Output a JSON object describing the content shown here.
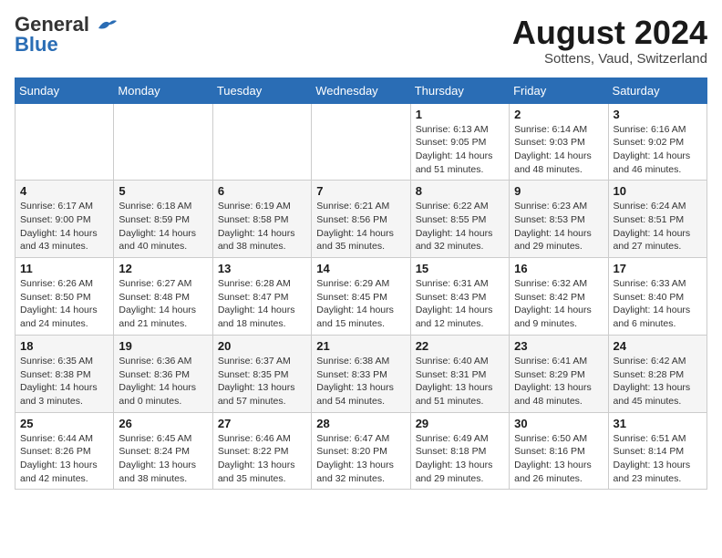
{
  "header": {
    "logo_line1": "General",
    "logo_line2": "Blue",
    "month_year": "August 2024",
    "location": "Sottens, Vaud, Switzerland"
  },
  "days_of_week": [
    "Sunday",
    "Monday",
    "Tuesday",
    "Wednesday",
    "Thursday",
    "Friday",
    "Saturday"
  ],
  "weeks": [
    {
      "days": [
        {
          "number": "",
          "info": ""
        },
        {
          "number": "",
          "info": ""
        },
        {
          "number": "",
          "info": ""
        },
        {
          "number": "",
          "info": ""
        },
        {
          "number": "1",
          "info": "Sunrise: 6:13 AM\nSunset: 9:05 PM\nDaylight: 14 hours\nand 51 minutes."
        },
        {
          "number": "2",
          "info": "Sunrise: 6:14 AM\nSunset: 9:03 PM\nDaylight: 14 hours\nand 48 minutes."
        },
        {
          "number": "3",
          "info": "Sunrise: 6:16 AM\nSunset: 9:02 PM\nDaylight: 14 hours\nand 46 minutes."
        }
      ]
    },
    {
      "days": [
        {
          "number": "4",
          "info": "Sunrise: 6:17 AM\nSunset: 9:00 PM\nDaylight: 14 hours\nand 43 minutes."
        },
        {
          "number": "5",
          "info": "Sunrise: 6:18 AM\nSunset: 8:59 PM\nDaylight: 14 hours\nand 40 minutes."
        },
        {
          "number": "6",
          "info": "Sunrise: 6:19 AM\nSunset: 8:58 PM\nDaylight: 14 hours\nand 38 minutes."
        },
        {
          "number": "7",
          "info": "Sunrise: 6:21 AM\nSunset: 8:56 PM\nDaylight: 14 hours\nand 35 minutes."
        },
        {
          "number": "8",
          "info": "Sunrise: 6:22 AM\nSunset: 8:55 PM\nDaylight: 14 hours\nand 32 minutes."
        },
        {
          "number": "9",
          "info": "Sunrise: 6:23 AM\nSunset: 8:53 PM\nDaylight: 14 hours\nand 29 minutes."
        },
        {
          "number": "10",
          "info": "Sunrise: 6:24 AM\nSunset: 8:51 PM\nDaylight: 14 hours\nand 27 minutes."
        }
      ]
    },
    {
      "days": [
        {
          "number": "11",
          "info": "Sunrise: 6:26 AM\nSunset: 8:50 PM\nDaylight: 14 hours\nand 24 minutes."
        },
        {
          "number": "12",
          "info": "Sunrise: 6:27 AM\nSunset: 8:48 PM\nDaylight: 14 hours\nand 21 minutes."
        },
        {
          "number": "13",
          "info": "Sunrise: 6:28 AM\nSunset: 8:47 PM\nDaylight: 14 hours\nand 18 minutes."
        },
        {
          "number": "14",
          "info": "Sunrise: 6:29 AM\nSunset: 8:45 PM\nDaylight: 14 hours\nand 15 minutes."
        },
        {
          "number": "15",
          "info": "Sunrise: 6:31 AM\nSunset: 8:43 PM\nDaylight: 14 hours\nand 12 minutes."
        },
        {
          "number": "16",
          "info": "Sunrise: 6:32 AM\nSunset: 8:42 PM\nDaylight: 14 hours\nand 9 minutes."
        },
        {
          "number": "17",
          "info": "Sunrise: 6:33 AM\nSunset: 8:40 PM\nDaylight: 14 hours\nand 6 minutes."
        }
      ]
    },
    {
      "days": [
        {
          "number": "18",
          "info": "Sunrise: 6:35 AM\nSunset: 8:38 PM\nDaylight: 14 hours\nand 3 minutes."
        },
        {
          "number": "19",
          "info": "Sunrise: 6:36 AM\nSunset: 8:36 PM\nDaylight: 14 hours\nand 0 minutes."
        },
        {
          "number": "20",
          "info": "Sunrise: 6:37 AM\nSunset: 8:35 PM\nDaylight: 13 hours\nand 57 minutes."
        },
        {
          "number": "21",
          "info": "Sunrise: 6:38 AM\nSunset: 8:33 PM\nDaylight: 13 hours\nand 54 minutes."
        },
        {
          "number": "22",
          "info": "Sunrise: 6:40 AM\nSunset: 8:31 PM\nDaylight: 13 hours\nand 51 minutes."
        },
        {
          "number": "23",
          "info": "Sunrise: 6:41 AM\nSunset: 8:29 PM\nDaylight: 13 hours\nand 48 minutes."
        },
        {
          "number": "24",
          "info": "Sunrise: 6:42 AM\nSunset: 8:28 PM\nDaylight: 13 hours\nand 45 minutes."
        }
      ]
    },
    {
      "days": [
        {
          "number": "25",
          "info": "Sunrise: 6:44 AM\nSunset: 8:26 PM\nDaylight: 13 hours\nand 42 minutes."
        },
        {
          "number": "26",
          "info": "Sunrise: 6:45 AM\nSunset: 8:24 PM\nDaylight: 13 hours\nand 38 minutes."
        },
        {
          "number": "27",
          "info": "Sunrise: 6:46 AM\nSunset: 8:22 PM\nDaylight: 13 hours\nand 35 minutes."
        },
        {
          "number": "28",
          "info": "Sunrise: 6:47 AM\nSunset: 8:20 PM\nDaylight: 13 hours\nand 32 minutes."
        },
        {
          "number": "29",
          "info": "Sunrise: 6:49 AM\nSunset: 8:18 PM\nDaylight: 13 hours\nand 29 minutes."
        },
        {
          "number": "30",
          "info": "Sunrise: 6:50 AM\nSunset: 8:16 PM\nDaylight: 13 hours\nand 26 minutes."
        },
        {
          "number": "31",
          "info": "Sunrise: 6:51 AM\nSunset: 8:14 PM\nDaylight: 13 hours\nand 23 minutes."
        }
      ]
    }
  ]
}
